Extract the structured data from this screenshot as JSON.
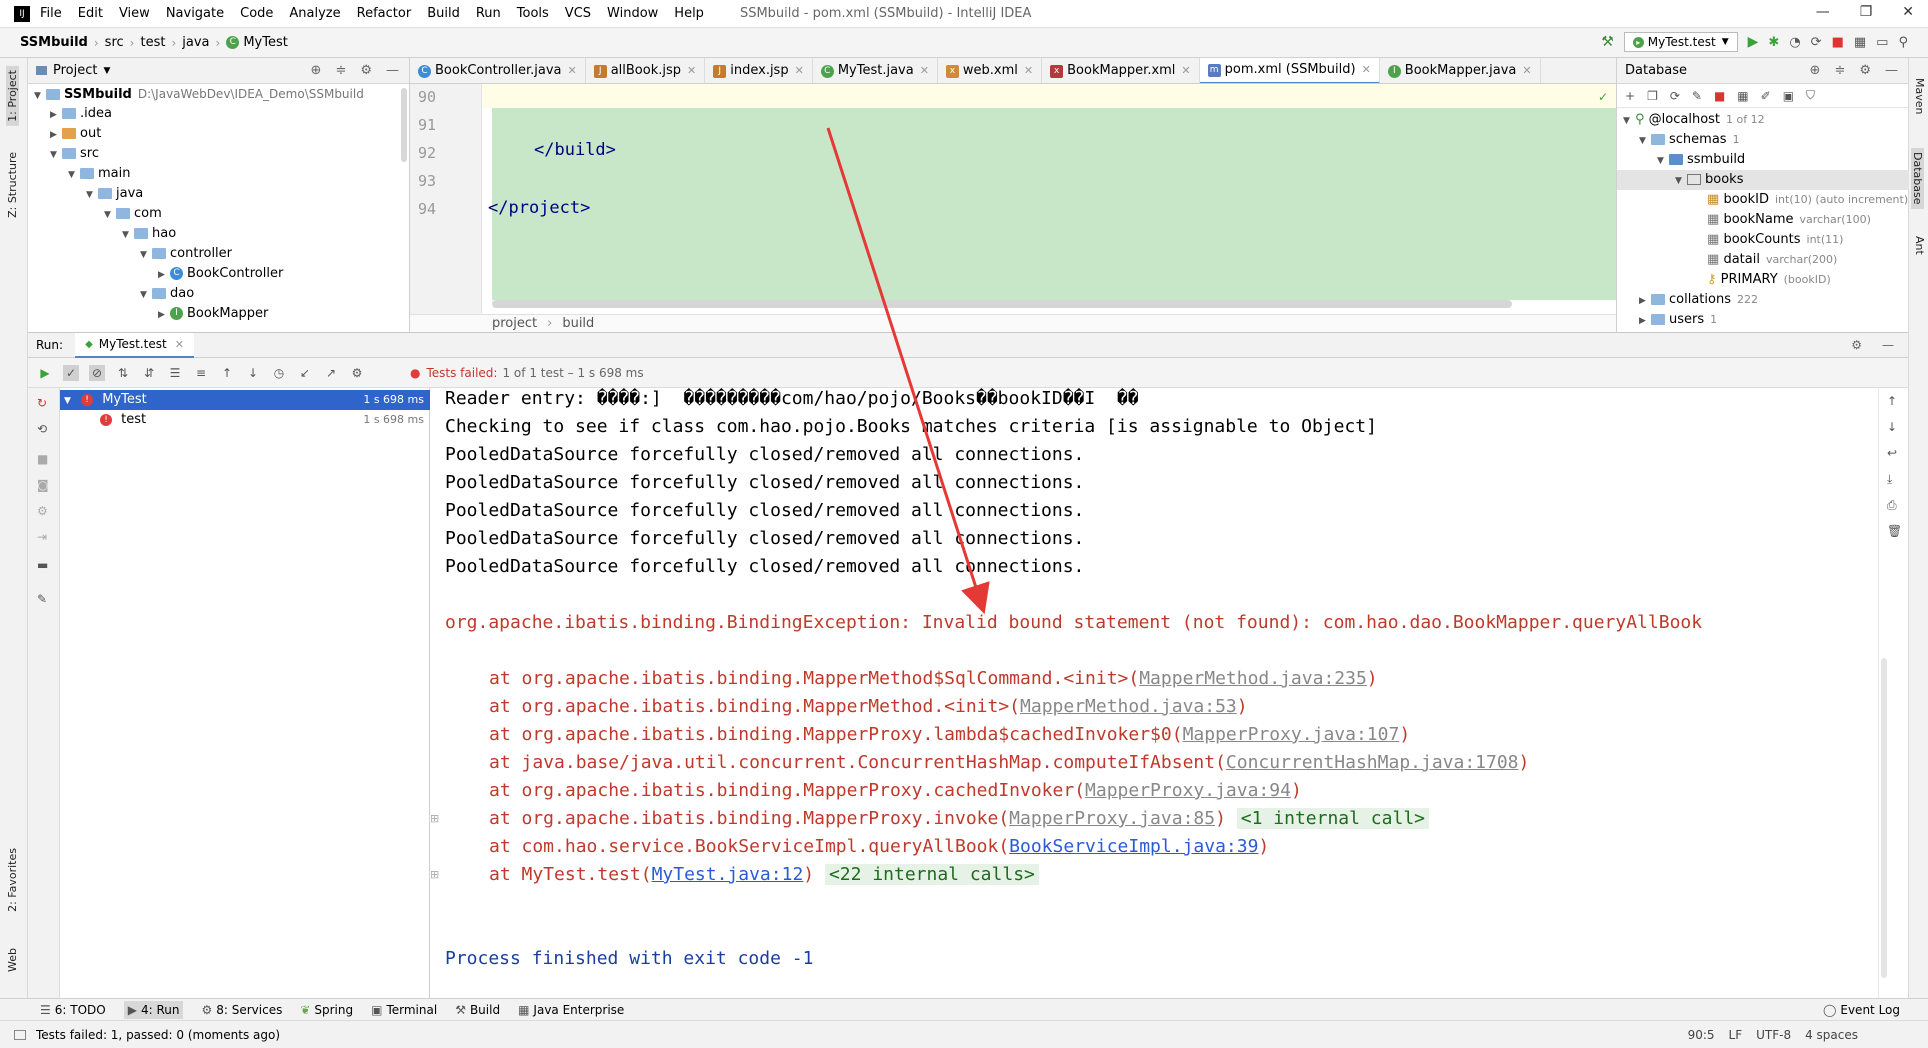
{
  "titlebar": {
    "menus": [
      "File",
      "Edit",
      "View",
      "Navigate",
      "Code",
      "Analyze",
      "Refactor",
      "Build",
      "Run",
      "Tools",
      "VCS",
      "Window",
      "Help"
    ],
    "title": "SSMbuild - pom.xml (SSMbuild) - IntelliJ IDEA"
  },
  "navbar": {
    "crumbs": [
      "SSMbuild",
      "src",
      "test",
      "java",
      "MyTest"
    ],
    "run_config": "MyTest.test"
  },
  "sidebar_left": {
    "project": "1: Project",
    "structure": "Z: Structure",
    "favorites": "2: Favorites",
    "web": "Web"
  },
  "sidebar_right": {
    "maven": "Maven",
    "database": "Database",
    "ant": "Ant"
  },
  "project": {
    "header": "Project",
    "tree": [
      {
        "label": "SSMbuild",
        "path": "D:\\JavaWebDev\\IDEA_Demo\\SSMbuild"
      },
      {
        "label": ".idea"
      },
      {
        "label": "out"
      },
      {
        "label": "src"
      },
      {
        "label": "main"
      },
      {
        "label": "java"
      },
      {
        "label": "com"
      },
      {
        "label": "hao"
      },
      {
        "label": "controller"
      },
      {
        "label": "BookController"
      },
      {
        "label": "dao"
      },
      {
        "label": "BookMapper"
      }
    ]
  },
  "editor": {
    "tabs": [
      "BookController.java",
      "allBook.jsp",
      "index.jsp",
      "MyTest.java",
      "web.xml",
      "BookMapper.xml",
      "pom.xml (SSMbuild)",
      "BookMapper.java"
    ],
    "line_numbers": [
      "90",
      "91",
      "92",
      "93",
      "94"
    ],
    "lines": [
      "</build>",
      "</project>"
    ],
    "breadcrumb": [
      "project",
      "build"
    ]
  },
  "database": {
    "header": "Database",
    "host": "@localhost",
    "host_count": "1 of 12",
    "schemas": "schemas",
    "schemas_count": "1",
    "db": "ssmbuild",
    "table": "books",
    "columns": [
      {
        "name": "bookID",
        "type": "int(10) (auto increment)"
      },
      {
        "name": "bookName",
        "type": "varchar(100)"
      },
      {
        "name": "bookCounts",
        "type": "int(11)"
      },
      {
        "name": "datail",
        "type": "varchar(200)"
      },
      {
        "name": "PRIMARY",
        "type": "(bookID)"
      }
    ],
    "collations": "collations",
    "collations_count": "222",
    "users": "users",
    "users_count": "1"
  },
  "run": {
    "label": "Run:",
    "tab": "MyTest.test",
    "status": "Tests failed:",
    "status_detail": "1 of 1 test – 1 s 698 ms",
    "tree": [
      {
        "name": "MyTest",
        "time": "1 s 698 ms"
      },
      {
        "name": "test",
        "time": "1 s 698 ms"
      }
    ]
  },
  "console": {
    "line1": "Reader entry: ����:]  ���������com/hao/pojo/Books��bookID��I  ��",
    "line2": "Checking to see if class com.hao.pojo.Books matches criteria [is assignable to Object]",
    "pooled": "PooledDataSource forcefully closed/removed all connections.",
    "exception": "org.apache.ibatis.binding.BindingException: Invalid bound statement (not found): com.hao.dao.BookMapper.queryAllBook",
    "stack": [
      {
        "pre": "at org.apache.ibatis.binding.MapperMethod$SqlCommand.<init>(",
        "link": "MapperMethod.java:235",
        "post": ")",
        "hint": ""
      },
      {
        "pre": "at org.apache.ibatis.binding.MapperMethod.<init>(",
        "link": "MapperMethod.java:53",
        "post": ")",
        "hint": ""
      },
      {
        "pre": "at org.apache.ibatis.binding.MapperProxy.lambda$cachedInvoker$0(",
        "link": "MapperProxy.java:107",
        "post": ")",
        "hint": ""
      },
      {
        "pre": "at java.base/java.util.concurrent.ConcurrentHashMap.computeIfAbsent(",
        "link": "ConcurrentHashMap.java:1708",
        "post": ")",
        "hint": ""
      },
      {
        "pre": "at org.apache.ibatis.binding.MapperProxy.cachedInvoker(",
        "link": "MapperProxy.java:94",
        "post": ")",
        "hint": ""
      },
      {
        "pre": "at org.apache.ibatis.binding.MapperProxy.invoke(",
        "link": "MapperProxy.java:85",
        "post": ")",
        "hint": "<1 internal call>"
      },
      {
        "pre": "at com.hao.service.BookServiceImpl.queryAllBook(",
        "link": "BookServiceImpl.java:39",
        "post": ")",
        "hint": ""
      },
      {
        "pre": "at MyTest.test(",
        "link": "MyTest.java:12",
        "post": ")",
        "hint": "<22 internal calls>"
      }
    ],
    "exit": "Process finished with exit code -1"
  },
  "bottom_tabs": [
    "6: TODO",
    "4: Run",
    "8: Services",
    "Spring",
    "Terminal",
    "Build",
    "Java Enterprise"
  ],
  "event_log": "Event Log",
  "status": {
    "message": "Tests failed: 1, passed: 0 (moments ago)",
    "position": "90:5",
    "line_sep": "LF",
    "encoding": "UTF-8",
    "indent": "4 spaces"
  },
  "colors": {
    "accent": "#2f65ca",
    "error": "#c0392b",
    "arrow": "#e53935",
    "code_highlight": "#c8e6c8"
  }
}
